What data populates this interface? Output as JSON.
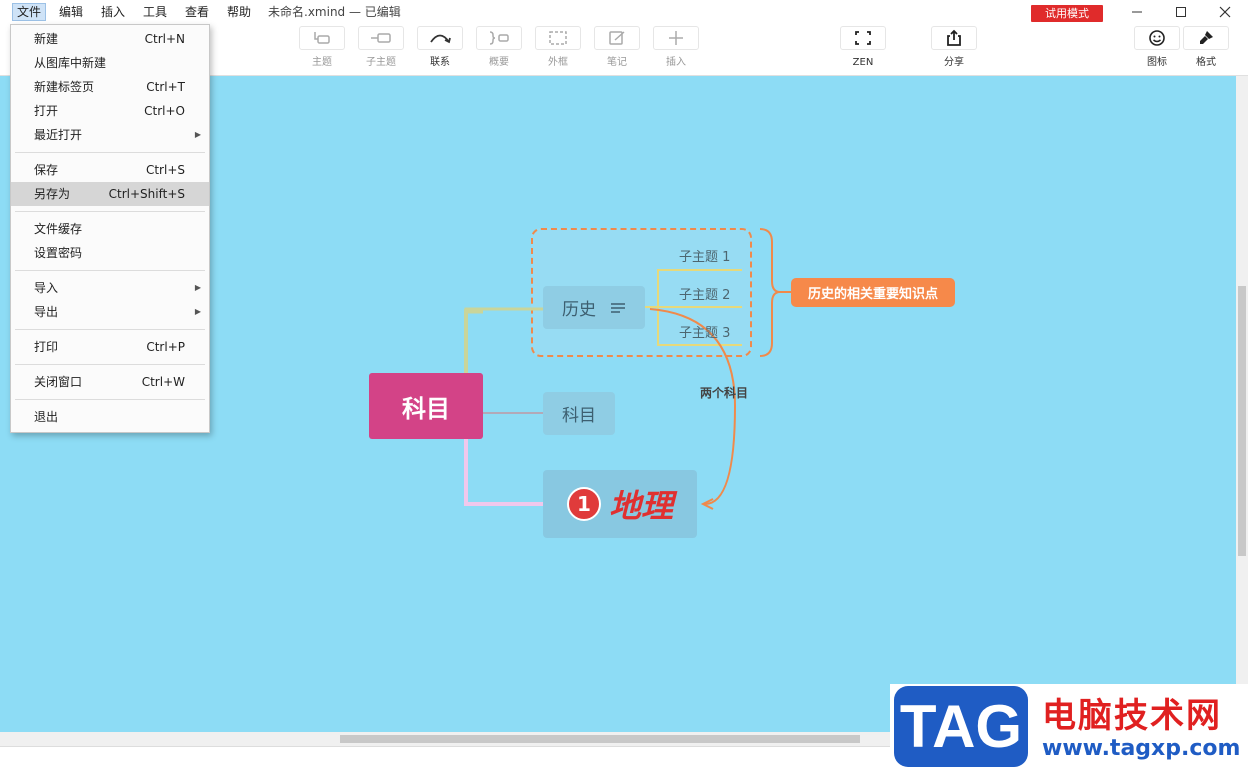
{
  "menu": {
    "items": [
      "文件",
      "编辑",
      "插入",
      "工具",
      "查看",
      "帮助"
    ],
    "doc_title": "未命名.xmind — 已编辑",
    "trial_badge": "试用模式"
  },
  "toolbar": {
    "topic": "主题",
    "subtopic": "子主题",
    "relation": "联系",
    "summary": "概要",
    "boundary": "外框",
    "note": "笔记",
    "insert": "插入",
    "zen": "ZEN",
    "share": "分享",
    "icon": "图标",
    "format": "格式"
  },
  "file_menu": {
    "new": {
      "label": "新建",
      "shortcut": "Ctrl+N"
    },
    "new_from_gallery": {
      "label": "从图库中新建"
    },
    "new_tab": {
      "label": "新建标签页",
      "shortcut": "Ctrl+T"
    },
    "open": {
      "label": "打开",
      "shortcut": "Ctrl+O"
    },
    "recent": {
      "label": "最近打开"
    },
    "save": {
      "label": "保存",
      "shortcut": "Ctrl+S"
    },
    "save_as": {
      "label": "另存为",
      "shortcut": "Ctrl+Shift+S"
    },
    "file_cache": {
      "label": "文件缓存"
    },
    "set_password": {
      "label": "设置密码"
    },
    "import": {
      "label": "导入"
    },
    "export": {
      "label": "导出"
    },
    "print": {
      "label": "打印",
      "shortcut": "Ctrl+P"
    },
    "close_window": {
      "label": "关闭窗口",
      "shortcut": "Ctrl+W"
    },
    "quit": {
      "label": "退出"
    }
  },
  "mindmap": {
    "central": "科目",
    "history": "历史",
    "subjects": "科目",
    "geography": "地理",
    "geo_marker": "1",
    "subtopics": [
      "子主题 1",
      "子主题 2",
      "子主题 3"
    ],
    "summary": "历史的相关重要知识点",
    "relation": "两个科目"
  },
  "watermark": {
    "tag": "TAG",
    "cn": "电脑技术网",
    "url": "www.tagxp.com"
  },
  "colors": {
    "canvas": "#8ddcf5",
    "central": "#d34387",
    "accent_orange": "#f6894a",
    "trial_red": "#e02b2b"
  }
}
